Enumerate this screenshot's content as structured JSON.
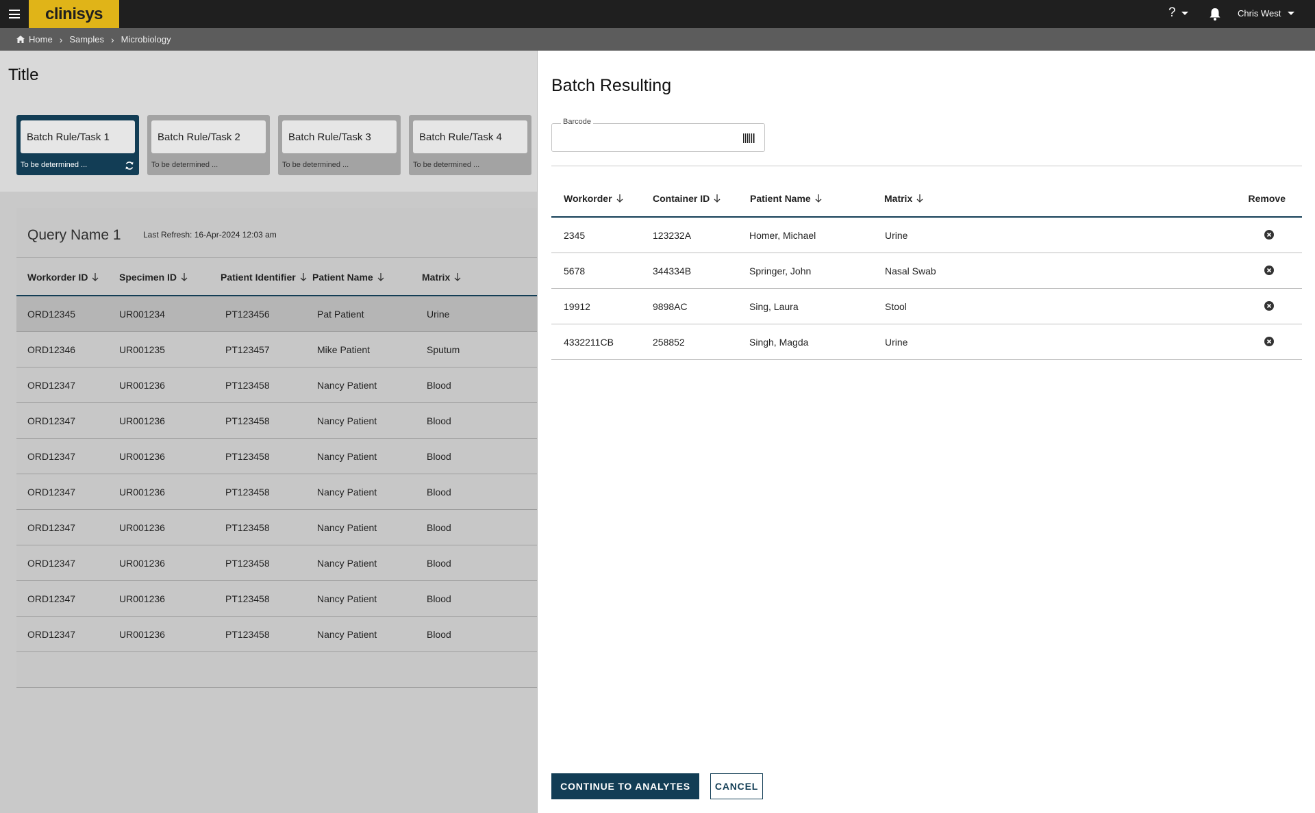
{
  "header": {
    "logo": "clinisys",
    "help": "?",
    "user": "Chris West"
  },
  "breadcrumb": [
    "Home",
    "Samples",
    "Microbiology"
  ],
  "page": {
    "title": "Title",
    "tasks": [
      {
        "label": "Batch Rule/Task 1",
        "sub": "To be determined ..."
      },
      {
        "label": "Batch Rule/Task 2",
        "sub": "To be determined ..."
      },
      {
        "label": "Batch Rule/Task 3",
        "sub": "To be determined ..."
      },
      {
        "label": "Batch Rule/Task 4",
        "sub": "To be determined ..."
      }
    ]
  },
  "query": {
    "name": "Query Name 1",
    "last_refresh": "Last Refresh: 16-Apr-2024 12:03 am",
    "columns": [
      "Workorder ID",
      "Specimen ID",
      "Patient Identifier",
      "Patient Name",
      "Matrix"
    ],
    "rows": [
      [
        "ORD12345",
        "UR001234",
        "PT123456",
        "Pat Patient",
        "Urine"
      ],
      [
        "ORD12346",
        "UR001235",
        "PT123457",
        "Mike Patient",
        "Sputum"
      ],
      [
        "ORD12347",
        "UR001236",
        "PT123458",
        "Nancy Patient",
        "Blood"
      ],
      [
        "ORD12347",
        "UR001236",
        "PT123458",
        "Nancy Patient",
        "Blood"
      ],
      [
        "ORD12347",
        "UR001236",
        "PT123458",
        "Nancy Patient",
        "Blood"
      ],
      [
        "ORD12347",
        "UR001236",
        "PT123458",
        "Nancy Patient",
        "Blood"
      ],
      [
        "ORD12347",
        "UR001236",
        "PT123458",
        "Nancy Patient",
        "Blood"
      ],
      [
        "ORD12347",
        "UR001236",
        "PT123458",
        "Nancy Patient",
        "Blood"
      ],
      [
        "ORD12347",
        "UR001236",
        "PT123458",
        "Nancy Patient",
        "Blood"
      ],
      [
        "ORD12347",
        "UR001236",
        "PT123458",
        "Nancy Patient",
        "Blood"
      ]
    ]
  },
  "drawer": {
    "title": "Batch Resulting",
    "barcode_label": "Barcode",
    "barcode_value": "",
    "columns": [
      "Workorder",
      "Container ID",
      "Patient Name",
      "Matrix",
      "Remove"
    ],
    "rows": [
      [
        "2345",
        "123232A",
        "Homer, Michael",
        "Urine"
      ],
      [
        "5678",
        "344334B",
        "Springer, John",
        "Nasal Swab"
      ],
      [
        "19912",
        "9898AC",
        "Sing, Laura",
        "Stool"
      ],
      [
        "4332211CB",
        "258852",
        "Singh, Magda",
        "Urine"
      ]
    ],
    "continue_label": "CONTINUE TO ANALYTES",
    "cancel_label": "CANCEL"
  },
  "colors": {
    "brand_yellow": "#e0b418",
    "accent_navy": "#123d55",
    "topbar": "#1f1f1f"
  }
}
